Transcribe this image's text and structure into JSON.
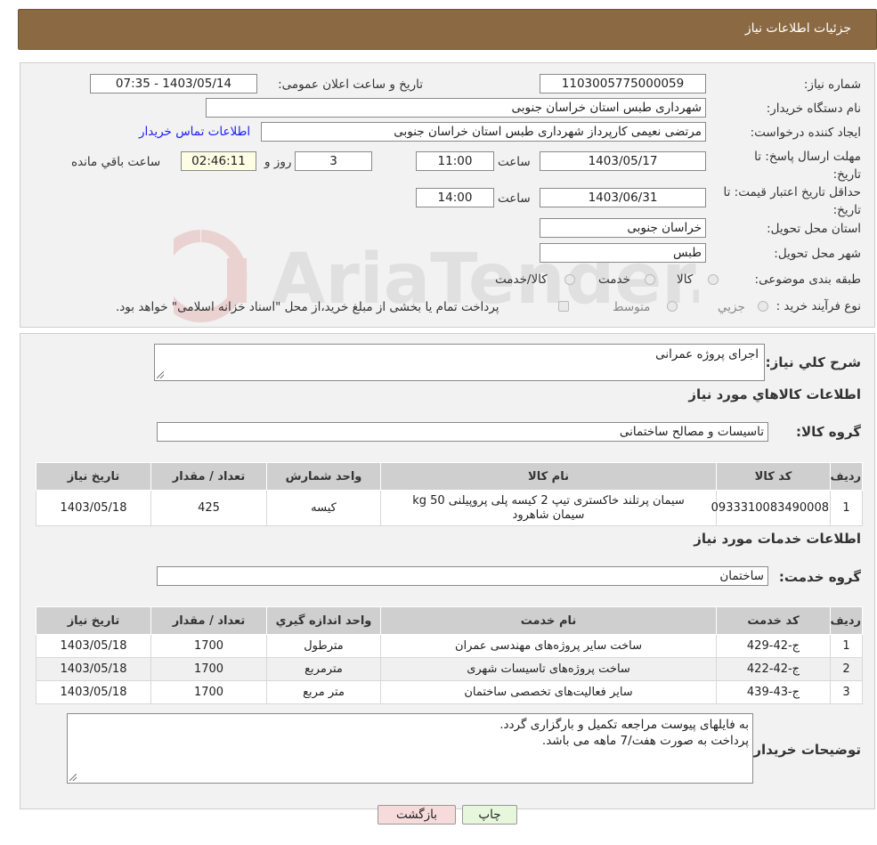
{
  "header": {
    "title": "جزئیات اطلاعات نیاز"
  },
  "form": {
    "need_number_label": "شماره نیاز:",
    "need_number": "1103005775000059",
    "announce_label": "تاریخ و ساعت اعلان عمومی:",
    "announce_value": "1403/05/14 - 07:35",
    "buyer_org_label": "نام دستگاه خریدار:",
    "buyer_org": "شهرداری طبس استان خراسان جنوبی",
    "creator_label": "ایجاد کننده درخواست:",
    "creator": "مرتضی نعیمی کارپرداز شهرداری طبس استان خراسان جنوبی",
    "contact_link": "اطلاعات تماس خریدار",
    "deadline_label": "مهلت ارسال پاسخ: تا تاریخ:",
    "deadline_date": "1403/05/17",
    "time_label": "ساعت",
    "deadline_time": "11:00",
    "days_value": "3",
    "days_label": "روز و",
    "remaining_time": "02:46:11",
    "remaining_label": "ساعت باقي مانده",
    "validity_label": "حداقل تاریخ اعتبار قیمت: تا تاریخ:",
    "validity_date": "1403/06/31",
    "validity_time": "14:00",
    "province_label": "استان محل تحویل:",
    "province": "خراسان جنوبی",
    "city_label": "شهر محل تحویل:",
    "city": "طبس",
    "category_label": "طبقه بندی موضوعی:",
    "category_options": [
      "کالا",
      "خدمت",
      "کالا/خدمت"
    ],
    "purchase_type_label": "نوع فرآیند خرید :",
    "purchase_options": [
      "جزیي",
      "متوسط"
    ],
    "payment_note": "پرداخت تمام یا بخشی از مبلغ خرید،از محل \"اسناد خزانه اسلامی\" خواهد بود."
  },
  "summary": {
    "label": "شرح كلي نياز:",
    "value": "اجرای پروژه عمرانی"
  },
  "goods": {
    "section_title": "اطلاعات كالاهاي مورد نياز",
    "group_label": "گروه كالا:",
    "group_value": "تاسیسات و مصالح ساختمانی",
    "columns": [
      "رديف",
      "كد كالا",
      "نام كالا",
      "واحد شمارش",
      "تعداد / مقدار",
      "تاریخ نیاز"
    ],
    "rows": [
      {
        "idx": "1",
        "code": "0933310083490008",
        "name_line1": "سیمان پرتلند خاکستری تیپ 2 کیسه پلی پروپیلنی 50 kg",
        "name_line2": "سیمان شاهرود",
        "unit": "کیسه",
        "qty": "425",
        "date": "1403/05/18"
      }
    ]
  },
  "services": {
    "section_title": "اطلاعات خدمات مورد نياز",
    "group_label": "گروه خدمت:",
    "group_value": "ساختمان",
    "columns": [
      "رديف",
      "كد خدمت",
      "نام خدمت",
      "واحد اندازه گيري",
      "تعداد / مقدار",
      "تاریخ نیاز"
    ],
    "rows": [
      {
        "idx": "1",
        "code": "ج-42-429",
        "name": "ساخت سایر پروژه‌های مهندسی عمران",
        "unit": "مترطول",
        "qty": "1700",
        "date": "1403/05/18"
      },
      {
        "idx": "2",
        "code": "ج-42-422",
        "name": "ساخت پروژه‌های تاسیسات شهری",
        "unit": "مترمربع",
        "qty": "1700",
        "date": "1403/05/18"
      },
      {
        "idx": "3",
        "code": "ج-43-439",
        "name": "سایر فعالیت‌های تخصصی ساختمان",
        "unit": "متر مربع",
        "qty": "1700",
        "date": "1403/05/18"
      }
    ]
  },
  "notes": {
    "label": "توضیحات خریدار:",
    "line1": "به فایلهای پیوست مراجعه تکمیل و بارگزاری گردد.",
    "line2": "پرداخت به صورت هفت/7 ماهه می باشد."
  },
  "buttons": {
    "print": "چاپ",
    "back": "بازگشت"
  },
  "watermark": {
    "text": "AriaTender.neT"
  },
  "colors": {
    "header": "#8b6a43",
    "link": "#1a1aff",
    "print_btn": "#e6f7dc",
    "back_btn": "#f7dada"
  }
}
